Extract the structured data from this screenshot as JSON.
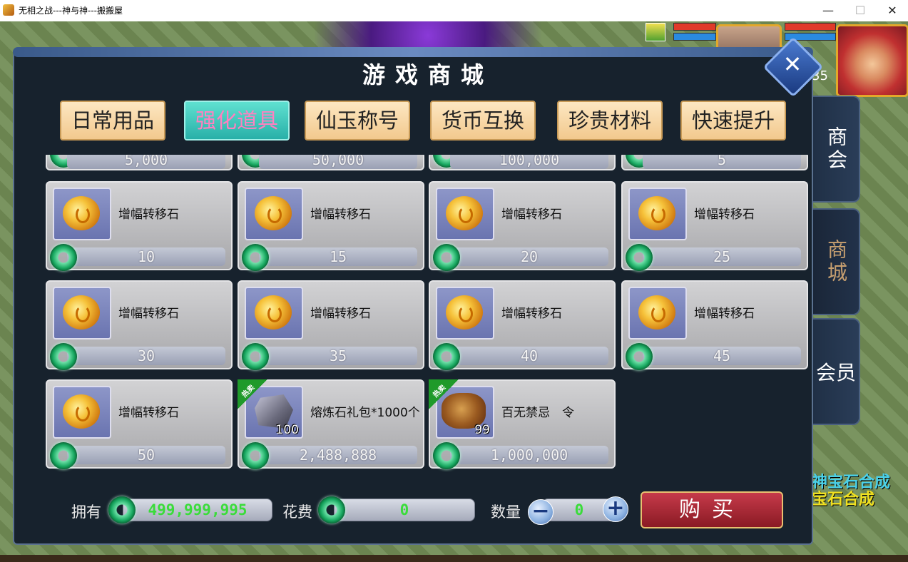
{
  "window": {
    "title": "无相之战---神与神---搬搬屋",
    "minimize": "—",
    "maximize": "☐",
    "close": "✕"
  },
  "hud": {
    "level": "35",
    "side_tabs": [
      "商会",
      "商城",
      "会员"
    ],
    "scene_text_1": "神宝石合成",
    "scene_text_2": "宝石合成",
    "gift_icon": "gift-icon"
  },
  "shop": {
    "title": "游戏商城",
    "close_label": "✕",
    "categories": [
      {
        "label": "日常用品",
        "active": false
      },
      {
        "label": "强化道具",
        "active": true
      },
      {
        "label": "仙玉称号",
        "active": false
      },
      {
        "label": "货币互换",
        "active": false
      },
      {
        "label": "珍贵材料",
        "active": false
      },
      {
        "label": "快速提升",
        "active": false
      }
    ],
    "partial_row_prices": [
      "5,000",
      "50,000",
      "100,000",
      "5"
    ],
    "items": [
      {
        "name": "增幅转移石",
        "price": "10",
        "icon": "amplify-stone-icon"
      },
      {
        "name": "增幅转移石",
        "price": "15",
        "icon": "amplify-stone-icon"
      },
      {
        "name": "增幅转移石",
        "price": "20",
        "icon": "amplify-stone-icon"
      },
      {
        "name": "增幅转移石",
        "price": "25",
        "icon": "amplify-stone-icon"
      },
      {
        "name": "增幅转移石",
        "price": "30",
        "icon": "amplify-stone-icon"
      },
      {
        "name": "增幅转移石",
        "price": "35",
        "icon": "amplify-stone-icon"
      },
      {
        "name": "增幅转移石",
        "price": "40",
        "icon": "amplify-stone-icon"
      },
      {
        "name": "增幅转移石",
        "price": "45",
        "icon": "amplify-stone-icon"
      },
      {
        "name": "增幅转移石",
        "price": "50",
        "icon": "amplify-stone-icon"
      },
      {
        "name": "熔炼石礼包*1000个",
        "price": "2,488,888",
        "icon": "smelting-stone-icon",
        "count": "100",
        "hot": "热卖"
      },
      {
        "name": "百无禁忌　令",
        "price": "1,000,000",
        "icon": "token-icon",
        "count": "99",
        "hot": "热卖"
      }
    ],
    "footer": {
      "own_label": "拥有",
      "own_value": "499,999,995",
      "cost_label": "花费",
      "cost_value": "0",
      "qty_label": "数量",
      "qty_value": "0",
      "minus": "−",
      "plus": "+",
      "buy_label": "购买"
    }
  }
}
